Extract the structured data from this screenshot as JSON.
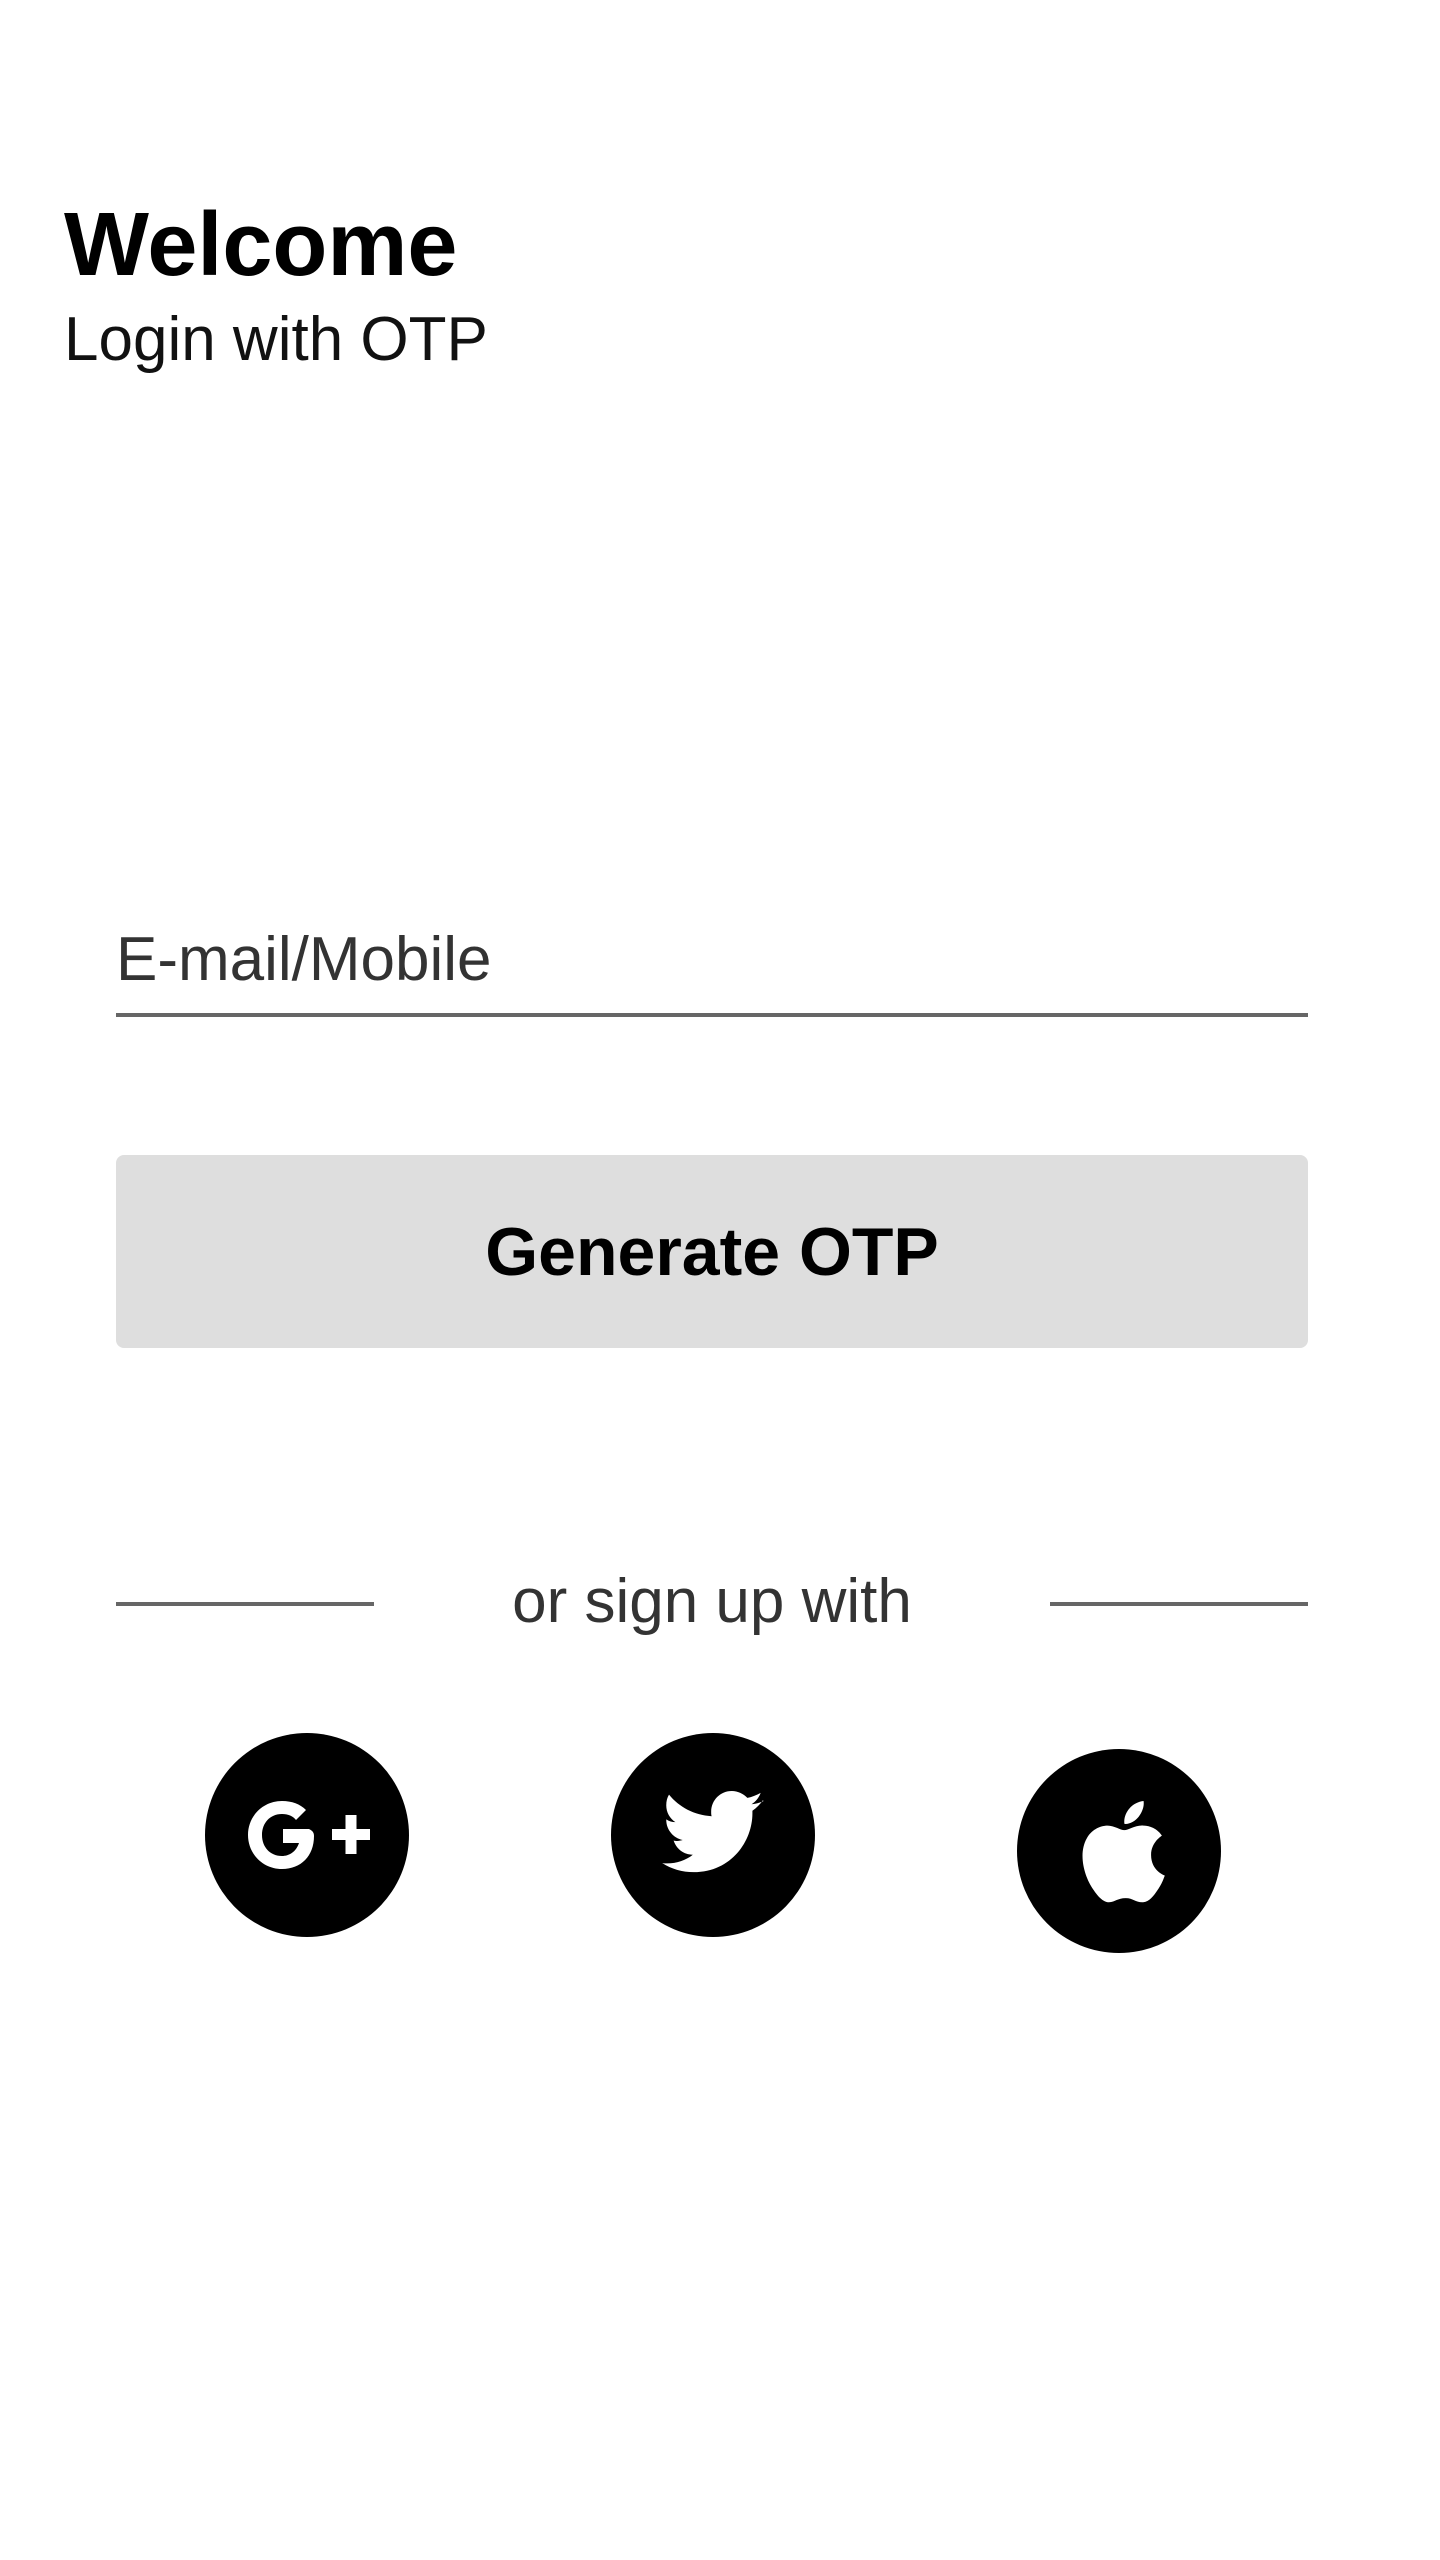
{
  "header": {
    "title": "Welcome",
    "subtitle": "Login with OTP"
  },
  "form": {
    "identifier_placeholder": "E-mail/Mobile",
    "identifier_value": "",
    "submit_label": "Generate OTP"
  },
  "social": {
    "divider_text": "or sign up with",
    "providers": [
      {
        "name": "Google Plus",
        "icon": "google-plus-icon"
      },
      {
        "name": "Twitter",
        "icon": "twitter-icon"
      },
      {
        "name": "Apple",
        "icon": "apple-icon"
      }
    ]
  },
  "colors": {
    "background": "#ffffff",
    "button_bg": "#dedede",
    "underline": "#666666",
    "icon_bg": "#000000"
  }
}
